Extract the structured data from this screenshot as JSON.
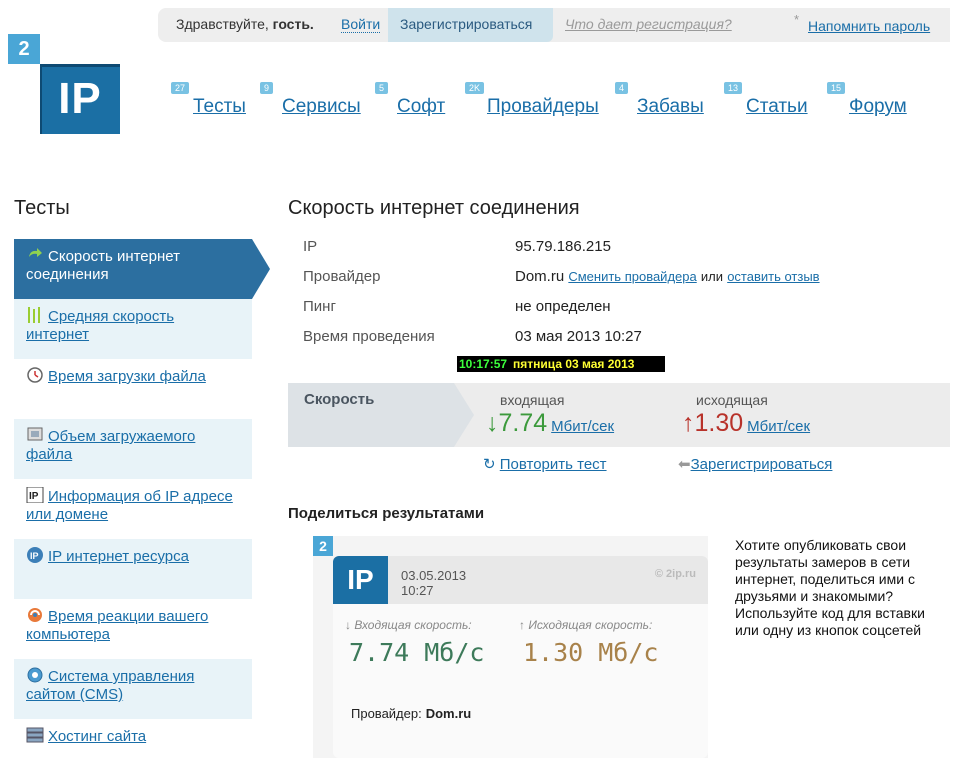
{
  "topbar": {
    "greeting": "Здравствуйте,",
    "guest": "гость.",
    "login": "Войти",
    "register": "Зарегистрироваться",
    "why_register": "Что дает регистрация?",
    "star": "*",
    "remind_password": "Напомнить пароль"
  },
  "logo": {
    "small": "2",
    "big": "IP"
  },
  "nav": [
    {
      "count": "27",
      "label": "Тесты"
    },
    {
      "count": "9",
      "label": "Сервисы"
    },
    {
      "count": "5",
      "label": "Софт"
    },
    {
      "count": "2K",
      "label": "Провайдеры"
    },
    {
      "count": "4",
      "label": "Забавы"
    },
    {
      "count": "13",
      "label": "Статьи"
    },
    {
      "count": "15",
      "label": "Форум"
    }
  ],
  "sidebar": {
    "title": "Тесты",
    "items": [
      {
        "label": "Скорость интернет соединения",
        "icon": "refresh-arrow-icon"
      },
      {
        "label": "Средняя скорость интернет",
        "icon": "bars-icon"
      },
      {
        "label": "Время загрузки файла",
        "icon": "clock-icon"
      },
      {
        "label": "Объем загружаемого файла",
        "icon": "monitor-icon"
      },
      {
        "label": "Информация об IP адресе или домене",
        "icon": "ip-icon"
      },
      {
        "label": "IP интернет ресурса",
        "icon": "ip-circle-icon"
      },
      {
        "label": "Время реакции вашего компьютера",
        "icon": "sync-icon"
      },
      {
        "label": "Система управления сайтом (CMS)",
        "icon": "gear-icon"
      },
      {
        "label": "Хостинг сайта",
        "icon": "server-icon"
      }
    ]
  },
  "main": {
    "title": "Скорость интернет соединения",
    "rows": [
      {
        "label": "IP",
        "value": "95.79.186.215"
      },
      {
        "label": "Провайдер",
        "value": "Dom.ru"
      },
      {
        "label": "Пинг",
        "value": "не определен"
      },
      {
        "label": "Время проведения",
        "value": "03 мая 2013 10:27"
      }
    ],
    "change_provider": "Сменить провайдера",
    "or": "или",
    "leave_review": "оставить отзыв",
    "clock_time": "10:17:57",
    "clock_date": "пятница 03 мая 2013",
    "speed": {
      "label": "Скорость",
      "in_label": "входящая",
      "out_label": "исходящая",
      "in_arrow": "↓",
      "out_arrow": "↑",
      "in_value": "7.74",
      "out_value": "1.30",
      "unit": "Мбит/сек"
    },
    "repeat_test": "Повторить тест",
    "register": "Зарегистрироваться",
    "share_title": "Поделиться результатами",
    "card": {
      "small_logo": "2",
      "logo": "IP",
      "date": "03.05.2013",
      "time": "10:27",
      "site": "© 2ip.ru",
      "in_label": "↓ Входящая скорость:",
      "out_label": "↑ Исходящая скорость:",
      "in_value": "7.74 Мб/с",
      "out_value": "1.30 Мб/с",
      "provider_label": "Провайдер:",
      "provider": "Dom.ru"
    },
    "share_text": "Хотите опубликовать свои результаты замеров в сети интернет, поделиться ими с друзьями и знакомыми? Используйте код для вставки или одну из кнопок соцсетей"
  }
}
